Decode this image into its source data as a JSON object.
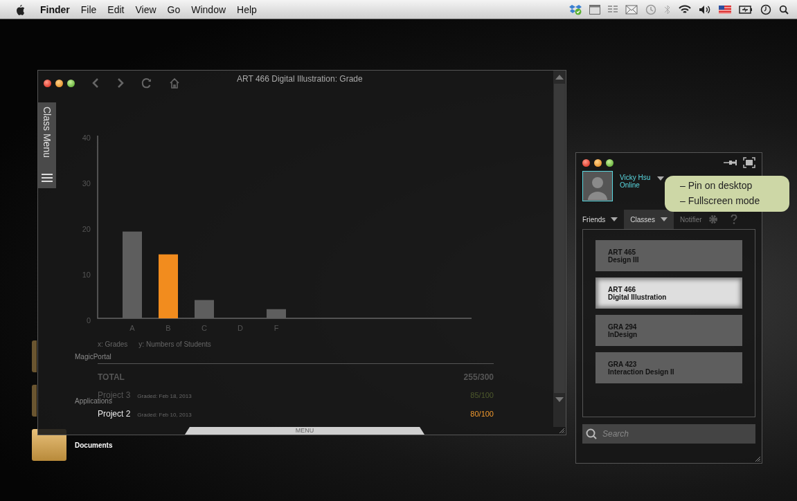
{
  "menu_bar": {
    "app_name": "Finder",
    "items": [
      "File",
      "Edit",
      "View",
      "Go",
      "Window",
      "Help"
    ]
  },
  "desktop_icons": [
    {
      "label": "MagicPortal"
    },
    {
      "label": "Applications"
    },
    {
      "label": "Documents"
    }
  ],
  "grade_window": {
    "title": "ART 466 Digital Illustration: Grade",
    "side_tab": "Class Menu",
    "chart_data": {
      "type": "bar",
      "categories": [
        "A",
        "B",
        "C",
        "D",
        "F"
      ],
      "stacked": true,
      "ylim": [
        0,
        40
      ],
      "yticks": [
        0,
        10,
        20,
        30,
        40
      ],
      "series": [
        {
          "color": "#5e5e5e",
          "values": [
            19,
            null,
            4,
            0,
            2
          ]
        },
        {
          "color": "#f28c1e",
          "values": [
            null,
            14,
            null,
            null,
            null
          ]
        }
      ]
    },
    "legend": [
      "x: Grades",
      "y: Numbers of Students"
    ],
    "total": {
      "label": "TOTAL",
      "score": "255/300"
    },
    "projects": [
      {
        "name": "Project 3",
        "graded": "Graded: Feb 18, 2013",
        "score": "85/100",
        "color": "#4e5a2c"
      },
      {
        "name": "Project 2",
        "graded": "Graded: Feb 10, 2013",
        "score": "80/100",
        "color": "#f29a2e"
      }
    ],
    "menu_tab": "MENU"
  },
  "classes_panel": {
    "user": {
      "name": "Vicky Hsu",
      "status": "Online"
    },
    "tabs": [
      {
        "label": "Friends",
        "selected": false
      },
      {
        "label": "Classes",
        "selected": true
      },
      {
        "label": "Notifier",
        "selected": false
      }
    ],
    "classes": [
      {
        "code": "ART 465",
        "title": "Design III",
        "selected": false
      },
      {
        "code": "ART 466",
        "title": "Digital Illustration",
        "selected": true
      },
      {
        "code": "GRA 294",
        "title": "InDesign",
        "selected": false
      },
      {
        "code": "GRA 423",
        "title": "Interaction Design II",
        "selected": false
      }
    ],
    "search": {
      "placeholder": "Search"
    }
  },
  "tooltip": {
    "lines": [
      "– Pin on desktop",
      "– Fullscreen mode"
    ]
  }
}
